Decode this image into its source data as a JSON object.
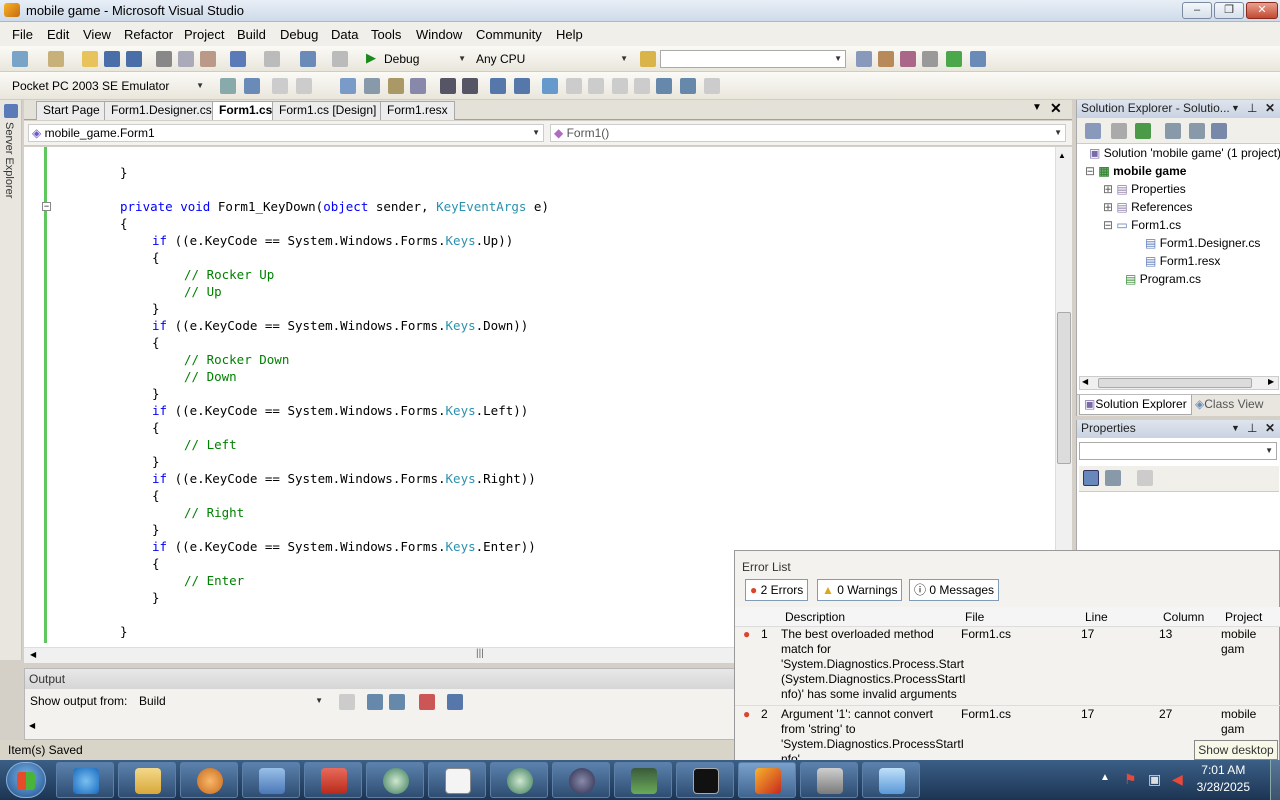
{
  "window": {
    "title": "mobile game - Microsoft Visual Studio"
  },
  "menu": [
    "File",
    "Edit",
    "View",
    "Refactor",
    "Project",
    "Build",
    "Debug",
    "Data",
    "Tools",
    "Window",
    "Community",
    "Help"
  ],
  "toolbar": {
    "config": "Debug",
    "platform": "Any CPU",
    "device": "Pocket PC 2003 SE Emulator"
  },
  "left_strip": {
    "label": "Server Explorer"
  },
  "doc_tabs": [
    "Start Page",
    "Form1.Designer.cs",
    "Form1.cs",
    "Form1.cs [Design]",
    "Form1.resx"
  ],
  "nav": {
    "class": "mobile_game.Form1",
    "member": "Form1()"
  },
  "code": {
    "l1": "}",
    "sig_kw1": "private void",
    "sig_name": " Form1_KeyDown(",
    "sig_kw2": "object",
    "sig_mid": " sender, ",
    "sig_type": "KeyEventArgs",
    "sig_end": " e)",
    "open": "{",
    "close": "}",
    "if_kw": "if",
    "if_pre": " ((e.KeyCode == System.Windows.Forms.",
    "keys": "Keys",
    "up": ".Up))",
    "down": ".Down))",
    "left": ".Left))",
    "right": ".Right))",
    "enter": ".Enter))",
    "c_rocker_up": "// Rocker Up",
    "c_up": "// Up",
    "c_rocker_down": "// Rocker Down",
    "c_down": "// Down",
    "c_left": "// Left",
    "c_right": "// Right",
    "c_enter": "// Enter"
  },
  "output": {
    "title": "Output",
    "show_from_label": "Show output from:",
    "show_from_value": "Build"
  },
  "status": {
    "text": "Item(s) Saved"
  },
  "solution_explorer": {
    "title": "Solution Explorer - Solutio...",
    "items": [
      "Solution 'mobile game' (1 project)",
      "mobile game",
      "Properties",
      "References",
      "Form1.cs",
      "Form1.Designer.cs",
      "Form1.resx",
      "Program.cs"
    ],
    "tabs": [
      "Solution Explorer",
      "Class View"
    ]
  },
  "properties": {
    "title": "Properties"
  },
  "error_list": {
    "title": "Error List",
    "errors_btn": "2 Errors",
    "warnings_btn": "0 Warnings",
    "messages_btn": "0 Messages",
    "columns": [
      "Description",
      "File",
      "Line",
      "Column",
      "Project"
    ],
    "rows": [
      {
        "num": "1",
        "desc": [
          "The best overloaded method",
          "match for",
          "'System.Diagnostics.Process.Start",
          "(System.Diagnostics.ProcessStartI",
          "nfo)' has some invalid arguments"
        ],
        "file": "Form1.cs",
        "line": "17",
        "col": "13",
        "project": "mobile gam"
      },
      {
        "num": "2",
        "desc": [
          "Argument '1': cannot convert",
          "from 'string' to",
          "'System.Diagnostics.ProcessStartI",
          "nfo'"
        ],
        "file": "Form1.cs",
        "line": "17",
        "col": "27",
        "project": "mobile gam"
      }
    ]
  },
  "taskbar": {
    "show_desktop": "Show desktop",
    "time": "7:01 AM",
    "date": "3/28/2025"
  },
  "colors": {
    "keyword": "#0000ff",
    "type": "#2b91af",
    "comment": "#008000",
    "error": "#d9472b"
  }
}
